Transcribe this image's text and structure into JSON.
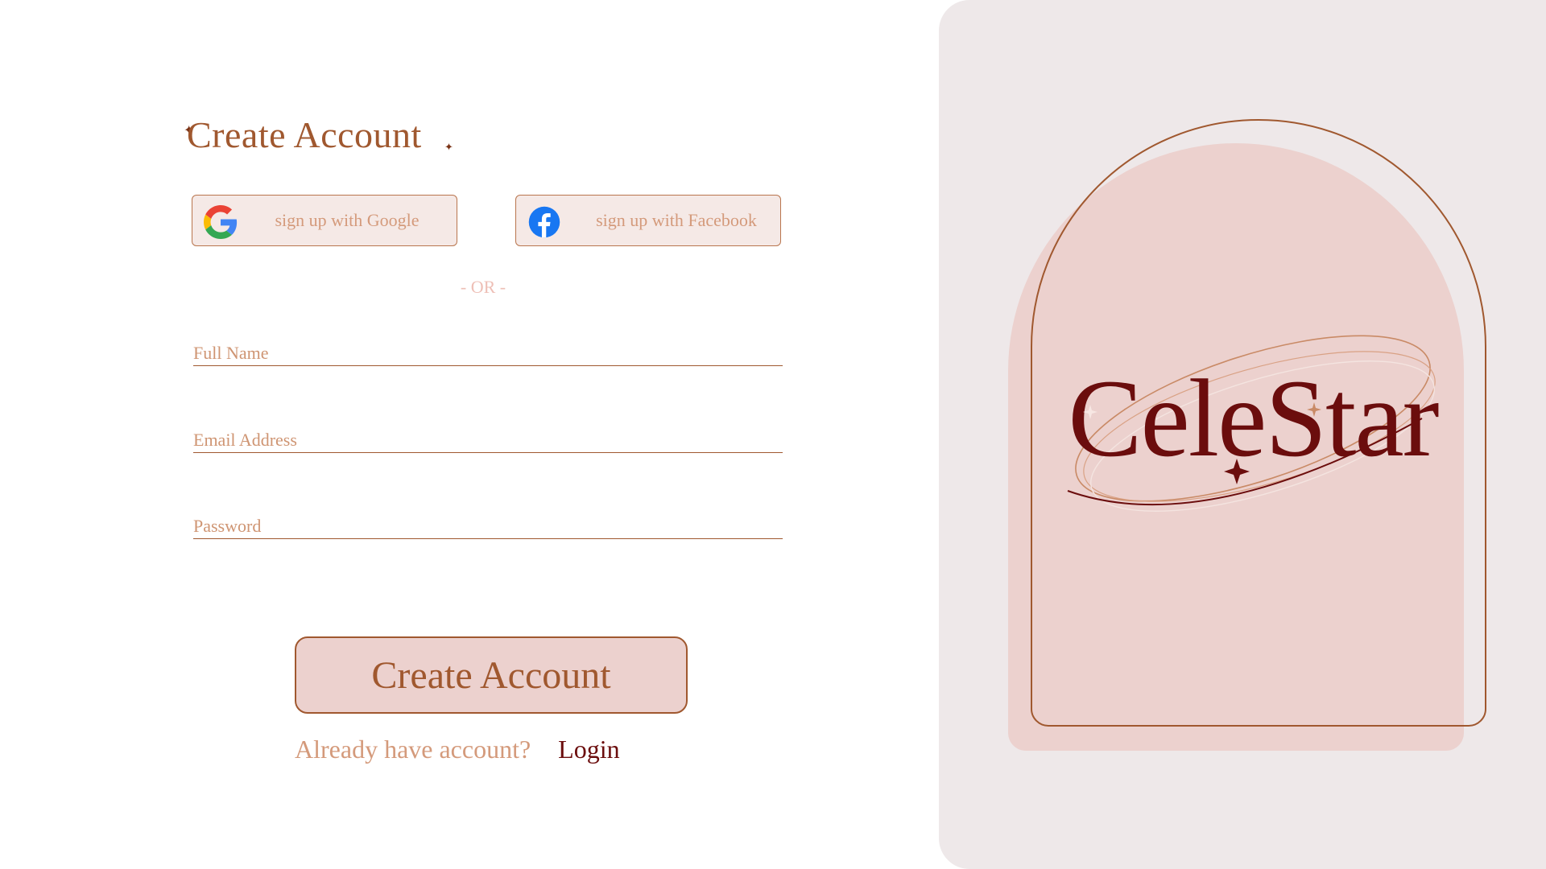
{
  "form": {
    "title": "Create Account",
    "social": {
      "google_label": "sign up with Google",
      "facebook_label": "sign up with Facebook"
    },
    "divider": "- OR -",
    "fields": {
      "full_name_placeholder": "Full Name",
      "email_placeholder": "Email Address",
      "password_placeholder": "Password"
    },
    "submit_label": "Create Account",
    "login_prompt": "Already have account?",
    "login_link": "Login"
  },
  "brand": {
    "name": "CeleStar"
  },
  "colors": {
    "accent_brown": "#a0582f",
    "label_tan": "#d49a7b",
    "button_pink": "#ecd1ce",
    "panel_grey": "#eee8e9",
    "logo_maroon": "#6b0d0d",
    "divider_pink": "#eebfb6"
  }
}
